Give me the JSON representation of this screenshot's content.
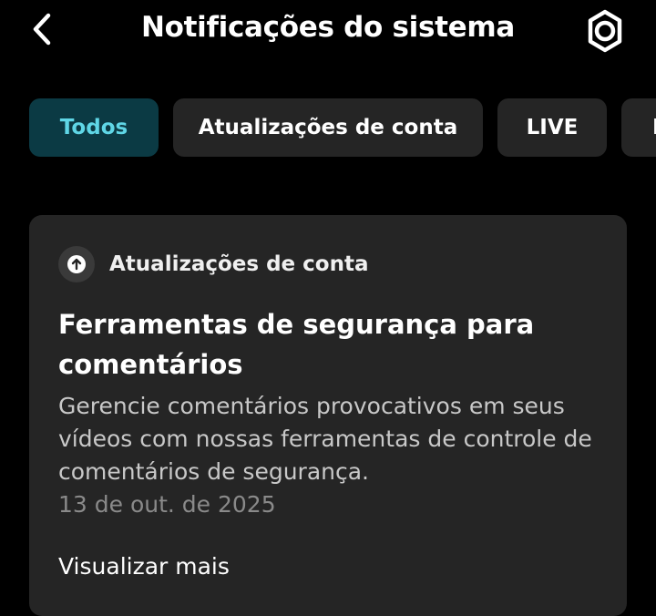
{
  "header": {
    "title": "Notificações do sistema",
    "back_icon": "chevron-left-icon",
    "settings_icon": "gear-icon"
  },
  "tabs": [
    {
      "label": "Todos",
      "active": true
    },
    {
      "label": "Atualizações de conta",
      "active": false
    },
    {
      "label": "LIVE",
      "active": false
    },
    {
      "label": "P",
      "active": false
    }
  ],
  "card": {
    "category_icon": "arrow-up-circle-icon",
    "category": "Atualizações de conta",
    "title": "Ferramentas de segurança para comentários",
    "body": "Gerencie comentários provocativos em seus vídeos com nossas ferramentas de controle de comentários de segurança.",
    "date": "13 de out. de 2025",
    "see_more": "Visualizar mais"
  },
  "colors": {
    "background": "#000000",
    "surface": "#252525",
    "active_tab_bg": "#0b3a44",
    "active_tab_text": "#5fd6e6"
  }
}
